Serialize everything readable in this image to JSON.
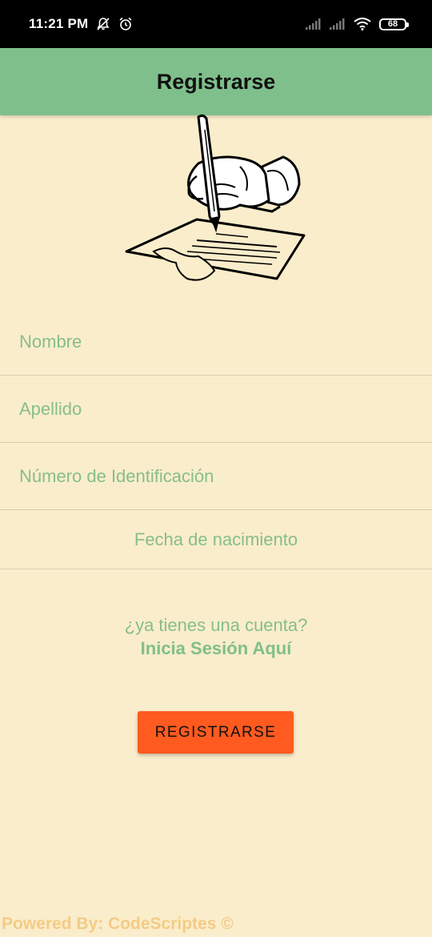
{
  "status_bar": {
    "time": "11:21 PM",
    "icons": [
      "mute-notifications-icon",
      "alarm-icon",
      "signal-icon",
      "signal-icon",
      "wifi-icon",
      "battery-icon"
    ],
    "battery_level": "68"
  },
  "app_bar": {
    "title": "Registrarse",
    "background": "#7FBF8B"
  },
  "illustration": {
    "icon": "hand-writing-document-icon"
  },
  "form": {
    "first_name_placeholder": "Nombre",
    "last_name_placeholder": "Apellido",
    "id_number_placeholder": "Número de Identificación",
    "birth_date_label": "Fecha de nacimiento"
  },
  "account": {
    "question": "¿ya tienes una cuenta?",
    "login_link": "Inicia Sesión Aquí"
  },
  "actions": {
    "register_label": "REGISTRARSE"
  },
  "footer": {
    "text": "Powered By: CodeScriptes ©"
  },
  "colors": {
    "background": "#FAEDCB",
    "accent_green": "#7FBF8B",
    "button_orange": "#FF5A1F",
    "footer_text": "#F3CB86"
  }
}
